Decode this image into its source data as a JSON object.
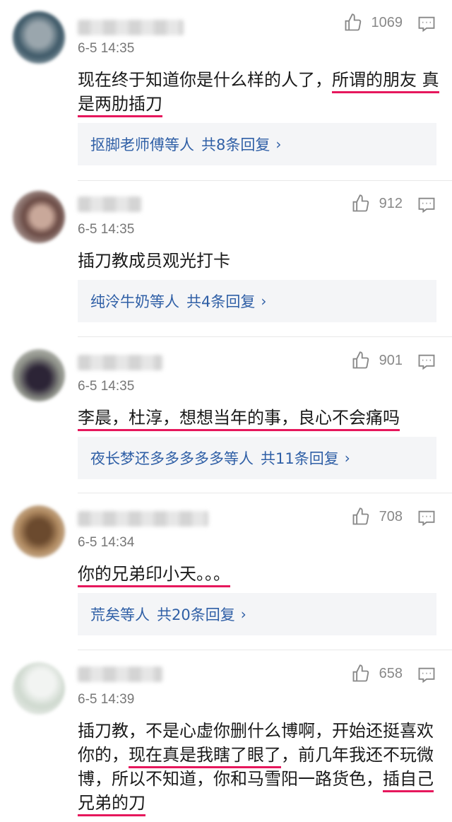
{
  "comments": [
    {
      "time": "6-5 14:35",
      "likes": "1069",
      "text_parts": [
        "现在终于知道你是什么样的人了，",
        "所谓的朋友 真是两肋插刀",
        ""
      ],
      "reply_names": "抠脚老师傅",
      "reply_suffix": "等人",
      "reply_count": "共8条回复"
    },
    {
      "time": "6-5 14:35",
      "likes": "912",
      "text": "插刀教成员观光打卡",
      "reply_names": "纯泠牛奶",
      "reply_suffix": "等人",
      "reply_count": "共4条回复"
    },
    {
      "time": "6-5 14:35",
      "likes": "901",
      "text": "李晨，杜淳，想想当年的事，良心不会痛吗",
      "reply_names": "夜长梦还多多多多多",
      "reply_suffix": "等人",
      "reply_count": "共11条回复"
    },
    {
      "time": "6-5 14:34",
      "likes": "708",
      "text": "你的兄弟印小天。。。",
      "reply_names": "荒矣",
      "reply_suffix": "等人",
      "reply_count": "共20条回复"
    },
    {
      "time": "6-5 14:39",
      "likes": "658",
      "text_parts": [
        "插刀教，不是心虚你删什么博啊，开始还挺喜欢你的，",
        "现在真是我瞎了眼了",
        "，前几年我还不玩微博，所以不知道，你和马雪阳一路货色，",
        "插自己兄弟的刀",
        ""
      ]
    }
  ],
  "reply_chevron": "›",
  "colors": {
    "underline": "#e6175c",
    "link": "#2f5fa6",
    "reply_bg": "#f4f5f7"
  }
}
